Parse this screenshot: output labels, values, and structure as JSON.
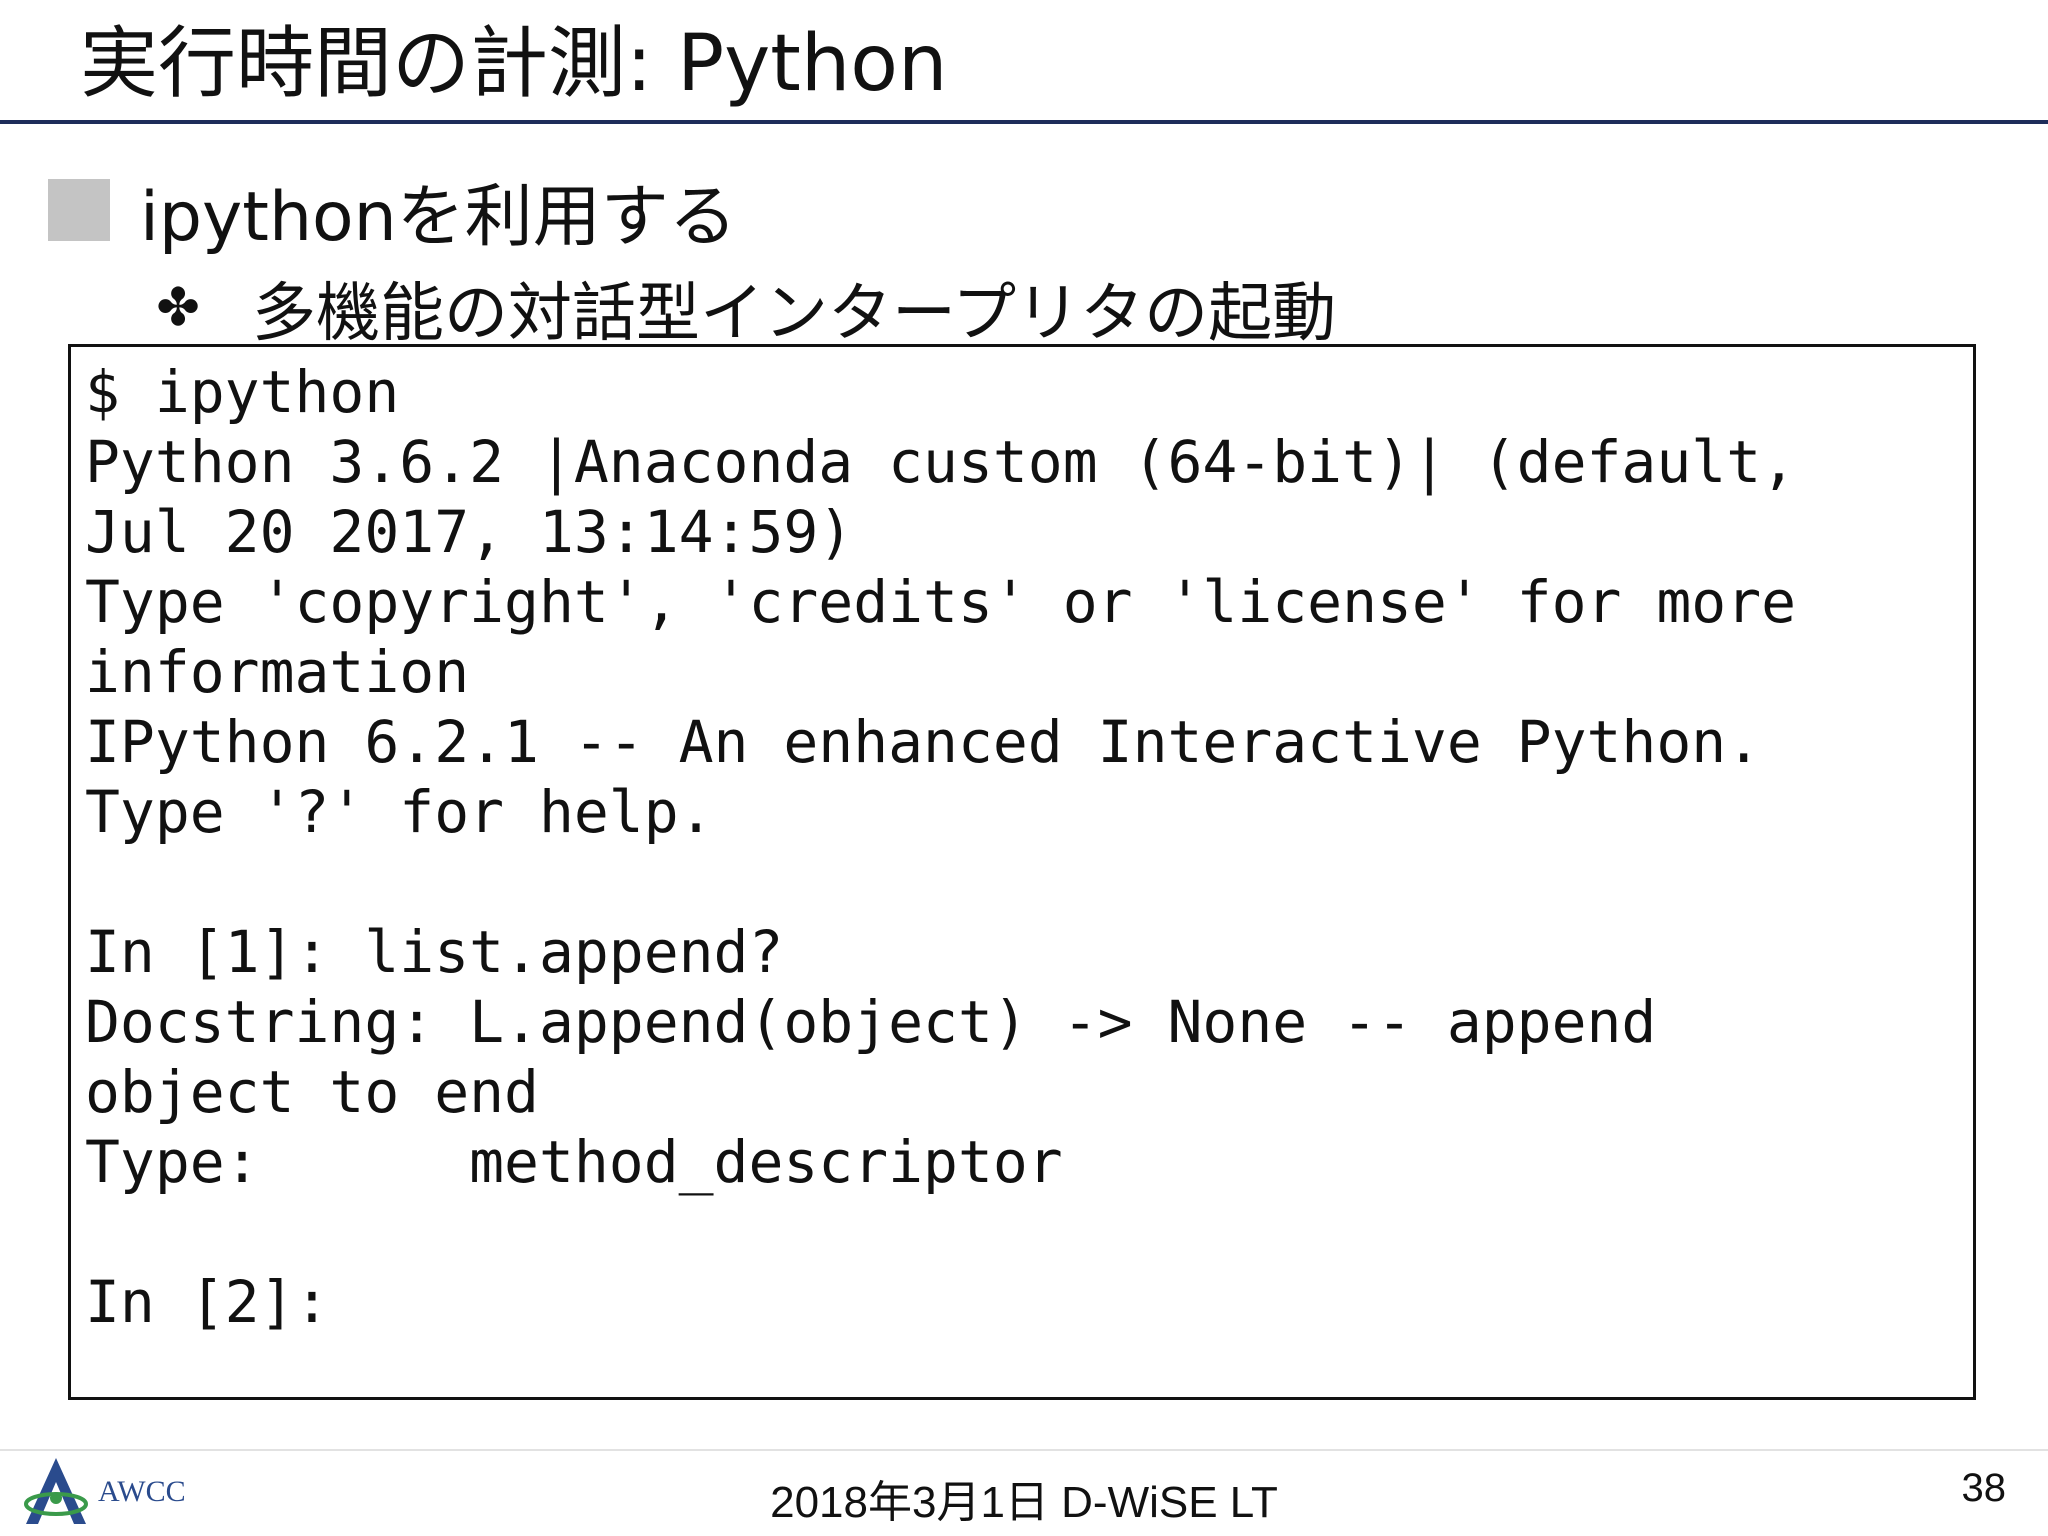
{
  "slide": {
    "title": "実行時間の計測: Python",
    "bullet_level1": "ipythonを利用する",
    "bullet_level2": "多機能の対話型インタープリタの起動"
  },
  "terminal": {
    "lines": [
      "$ ipython",
      "Python 3.6.2 |Anaconda custom (64-bit)| (default,",
      "Jul 20 2017, 13:14:59)",
      "Type 'copyright', 'credits' or 'license' for more",
      "information",
      "IPython 6.2.1 -- An enhanced Interactive Python.",
      "Type '?' for help.",
      "",
      "In [1]: list.append?",
      "Docstring: L.append(object) -> None -- append",
      "object to end",
      "Type:      method_descriptor",
      "",
      "In [2]:"
    ]
  },
  "footer": {
    "logo_text": "AWCC",
    "center_text": "2018年3月1日  D-WiSE LT",
    "page_number": "38"
  },
  "colors": {
    "title_rule": "#1e2d5a",
    "bullet_square": "#c4c4c4",
    "logo_blue": "#2a4b8d",
    "logo_green": "#3a9a4a"
  }
}
